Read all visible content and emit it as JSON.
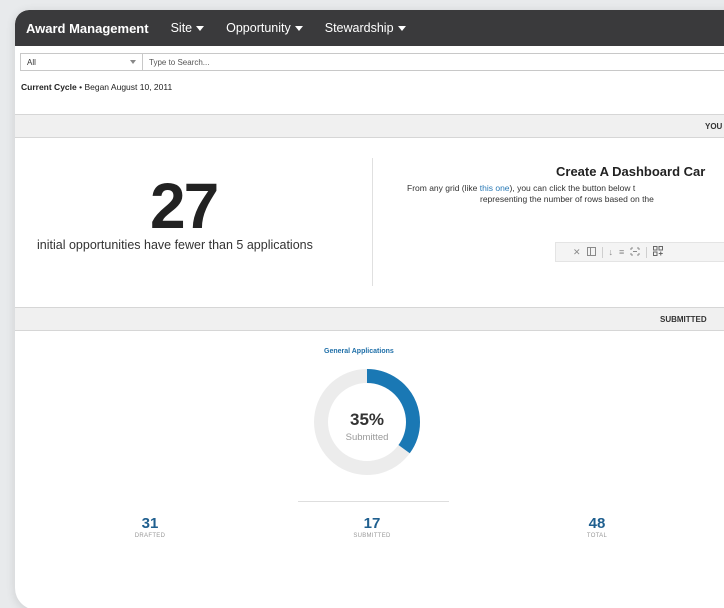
{
  "navbar": {
    "brand": "Award Management",
    "items": [
      {
        "label": "Site"
      },
      {
        "label": "Opportunity"
      },
      {
        "label": "Stewardship"
      }
    ]
  },
  "search": {
    "scope_value": "All",
    "placeholder": "Type to Search..."
  },
  "cycle": {
    "label": "Current Cycle",
    "began": " • Began August 10, 2011"
  },
  "sections": {
    "you_band": "YOU",
    "submitted_band": "SUBMITTED"
  },
  "metric": {
    "value": "27",
    "caption": "initial opportunities have fewer than 5 applications"
  },
  "dashboard_card": {
    "title": "Create A Dashboard Car",
    "desc_prefix": "From any grid (like ",
    "desc_link": "this one",
    "desc_suffix": "), you can click the button below t",
    "desc_line2": "representing the number of rows based on the"
  },
  "toolbar_icons": [
    "close-icon",
    "column-icon",
    "download-icon",
    "list-icon",
    "expand-icon",
    "dashboard-add-icon"
  ],
  "applications": {
    "title": "General Applications",
    "percent": "35%",
    "percent_value": 35,
    "percent_label": "Submitted",
    "accent_color": "#1a78b4",
    "track_color": "#ececec",
    "stats": [
      {
        "value": "31",
        "label": "DRAFTED"
      },
      {
        "value": "17",
        "label": "SUBMITTED"
      },
      {
        "value": "48",
        "label": "TOTAL"
      }
    ]
  }
}
